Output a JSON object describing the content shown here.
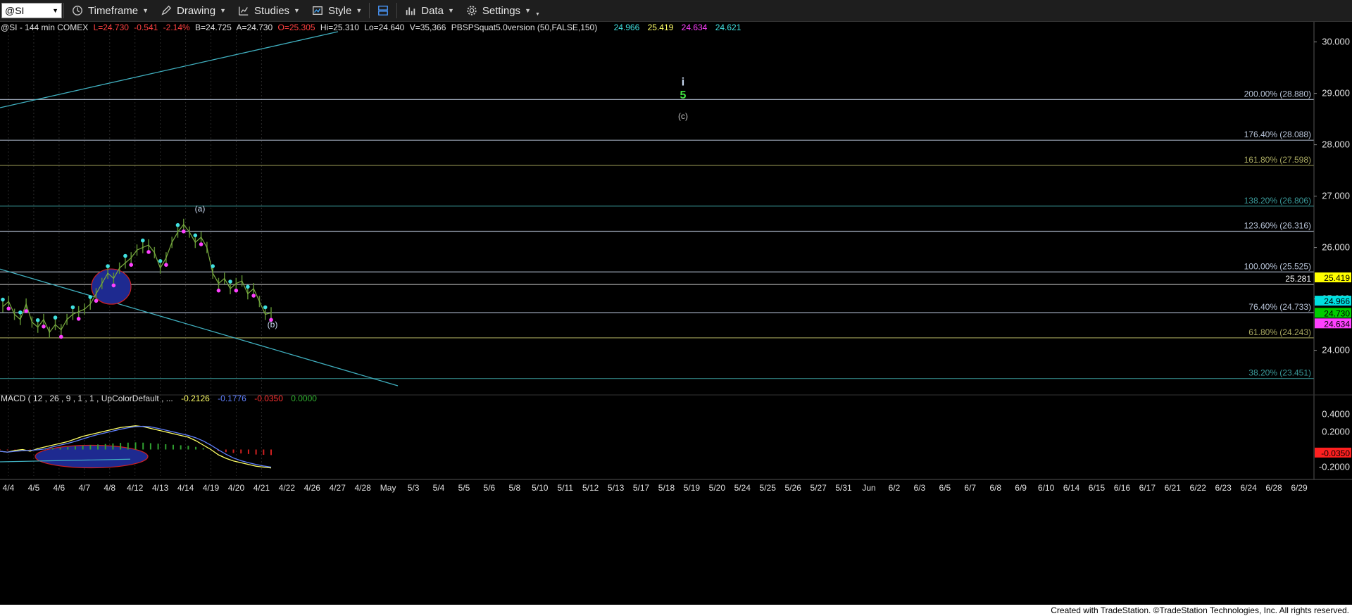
{
  "toolbar": {
    "symbol": "@SI",
    "buttons": [
      {
        "label": "Timeframe",
        "icon": "clock-icon"
      },
      {
        "label": "Drawing",
        "icon": "pencil-icon"
      },
      {
        "label": "Studies",
        "icon": "studies-icon"
      },
      {
        "label": "Style",
        "icon": "style-icon"
      },
      {
        "label": "Data",
        "icon": "data-icon"
      },
      {
        "label": "Settings",
        "icon": "gear-icon"
      }
    ]
  },
  "header": {
    "symbol_info": "@SI - 144 min  COMEX",
    "last": "L=24.730",
    "change": "-0.541",
    "change_pct": "-2.14%",
    "bid": "B=24.725",
    "ask": "A=24.730",
    "open": "O=25.305",
    "high": "Hi=25.310",
    "low": "Lo=24.640",
    "volume": "V=35,366",
    "study": "PBSPSquat5.0version (50,FALSE,150)",
    "study_values": [
      {
        "text": "24.966",
        "color": "#40e0e0"
      },
      {
        "text": "25.419",
        "color": "#ffff66"
      },
      {
        "text": "24.634",
        "color": "#ff40ff"
      },
      {
        "text": "24.621",
        "color": "#40e0e0"
      }
    ]
  },
  "macd_header": {
    "label": "MACD ( 12 , 26 , 9 , 1 , 1 , UpColorDefault , ...",
    "values": [
      {
        "text": "-0.2126",
        "color": "#ffff66"
      },
      {
        "text": "-0.1776",
        "color": "#6080ff"
      },
      {
        "text": "-0.0350",
        "color": "#ff3030"
      },
      {
        "text": "0.0000",
        "color": "#30b030"
      }
    ]
  },
  "price_axis": {
    "ticks": [
      "30.000",
      "29.000",
      "28.000",
      "27.000",
      "26.000",
      "25.000",
      "24.000"
    ],
    "tick_values": [
      30,
      29,
      28,
      27,
      26,
      25,
      24
    ],
    "range": [
      23.2,
      30.2
    ],
    "tags": [
      {
        "text": "25.419",
        "value": 25.419,
        "bg": "#ffff00",
        "fg": "#000"
      },
      {
        "text": "24.966",
        "value": 24.966,
        "bg": "#00e0e0",
        "fg": "#000"
      },
      {
        "text": "24.730",
        "value": 24.73,
        "bg": "#00cc00",
        "fg": "#000"
      },
      {
        "text": "24.634",
        "value": 24.634,
        "bg": "#ff40ff",
        "fg": "#000"
      }
    ]
  },
  "macd_axis": {
    "ticks": [
      "0.4000",
      "0.2000",
      "-0.2000"
    ],
    "tick_values": [
      0.4,
      0.2,
      -0.2
    ],
    "range": [
      -0.3,
      0.5
    ],
    "tag": {
      "text": "-0.0350",
      "value": -0.035,
      "bg": "#ff2020",
      "fg": "#000"
    }
  },
  "fib_levels": [
    {
      "label": "200.00% (28.880)",
      "value": 28.88,
      "color": "#b8c4d8"
    },
    {
      "label": "176.40% (28.088)",
      "value": 28.088,
      "color": "#b8c4d8"
    },
    {
      "label": "161.80% (27.598)",
      "value": 27.598,
      "color": "#a8a860"
    },
    {
      "label": "138.20% (26.806)",
      "value": 26.806,
      "color": "#3a9a9a"
    },
    {
      "label": "123.60% (26.316)",
      "value": 26.316,
      "color": "#b8c4d8"
    },
    {
      "label": "100.00% (25.525)",
      "value": 25.525,
      "color": "#b8c4d8"
    },
    {
      "label": "76.40% (24.733)",
      "value": 24.733,
      "color": "#b8c4d8"
    },
    {
      "label": "61.80% (24.243)",
      "value": 24.243,
      "color": "#a8a860"
    },
    {
      "label": "38.20% (23.451)",
      "value": 23.451,
      "color": "#3a9a9a"
    }
  ],
  "extra_line": {
    "label": "25.281",
    "value": 25.281,
    "color": "#ffffff"
  },
  "wave_labels": [
    {
      "text": "i",
      "value": 29.15,
      "x_index": 0,
      "color": "#c8d8f0",
      "bold": true
    },
    {
      "text": "5",
      "value": 28.9,
      "x_index": 0,
      "color": "#40e040",
      "bold": true
    },
    {
      "text": "(c)",
      "value": 28.5,
      "x_index": 0,
      "color": "#c8c8c8",
      "bold": false
    },
    {
      "text": "(a)",
      "value": 26.7,
      "x_index": 1,
      "color": "#c8d8f0",
      "bold": false
    },
    {
      "text": "(b)",
      "value": 24.45,
      "x_index": 2,
      "color": "#c8d8f0",
      "bold": false
    }
  ],
  "date_axis": [
    "4/4",
    "4/5",
    "4/6",
    "4/7",
    "4/8",
    "4/12",
    "4/13",
    "4/14",
    "4/19",
    "4/20",
    "4/21",
    "4/22",
    "4/26",
    "4/27",
    "4/28",
    "May",
    "5/3",
    "5/4",
    "5/5",
    "5/6",
    "5/8",
    "5/10",
    "5/11",
    "5/12",
    "5/13",
    "5/17",
    "5/18",
    "5/19",
    "5/20",
    "5/24",
    "5/25",
    "5/26",
    "5/27",
    "5/31",
    "Jun",
    "6/2",
    "6/3",
    "6/5",
    "6/7",
    "6/8",
    "6/9",
    "6/10",
    "6/14",
    "6/15",
    "6/16",
    "6/17",
    "6/21",
    "6/22",
    "6/23",
    "6/24",
    "6/28",
    "6/29"
  ],
  "chart_data": {
    "type": "line",
    "series": [
      {
        "values": [
          24.85,
          24.95,
          24.7,
          24.6,
          24.9,
          24.55,
          24.45,
          24.6,
          24.35,
          24.5,
          24.4,
          24.6,
          24.7,
          24.75,
          24.8,
          24.9,
          25.1,
          25.3,
          25.5,
          25.4,
          25.6,
          25.7,
          25.8,
          25.95,
          26.0,
          26.05,
          25.9,
          25.6,
          25.8,
          26.1,
          26.3,
          26.45,
          26.3,
          26.1,
          26.2,
          26.0,
          25.5,
          25.3,
          25.4,
          25.2,
          25.3,
          25.35,
          25.1,
          25.2,
          24.95,
          24.7,
          24.73
        ]
      }
    ],
    "macd": [
      -0.02,
      -0.03,
      -0.01,
      0.0,
      -0.02,
      0.01,
      0.03,
      0.05,
      0.07,
      0.09,
      0.12,
      0.15,
      0.17,
      0.19,
      0.21,
      0.23,
      0.25,
      0.26,
      0.27,
      0.26,
      0.24,
      0.22,
      0.2,
      0.18,
      0.16,
      0.14,
      0.1,
      0.05,
      0.0,
      -0.06,
      -0.1,
      -0.13,
      -0.15,
      -0.17,
      -0.19,
      -0.2,
      -0.21
    ]
  }
}
